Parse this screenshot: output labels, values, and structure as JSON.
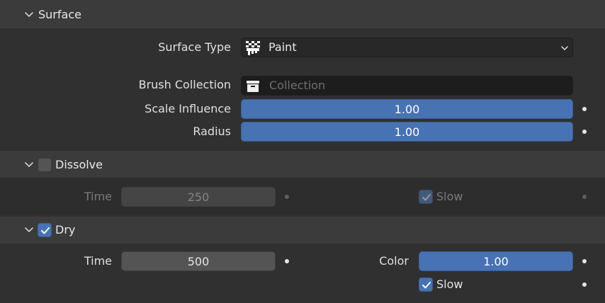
{
  "surface": {
    "header_label": "Surface",
    "surface_type_label": "Surface Type",
    "surface_type_value": "Paint",
    "brush_collection_label": "Brush Collection",
    "brush_collection_placeholder": "Collection",
    "scale_influence_label": "Scale Influence",
    "scale_influence_value": "1.00",
    "radius_label": "Radius",
    "radius_value": "1.00"
  },
  "dissolve": {
    "header_label": "Dissolve",
    "enabled": false,
    "time_label": "Time",
    "time_value": "250",
    "slow_label": "Slow",
    "slow_checked": true
  },
  "dry": {
    "header_label": "Dry",
    "enabled": true,
    "time_label": "Time",
    "time_value": "500",
    "color_label": "Color",
    "color_value": "1.00",
    "slow_label": "Slow",
    "slow_checked": true
  },
  "colors": {
    "accent": "#4772b3",
    "background": "#303030",
    "header": "#3b3b3b"
  }
}
